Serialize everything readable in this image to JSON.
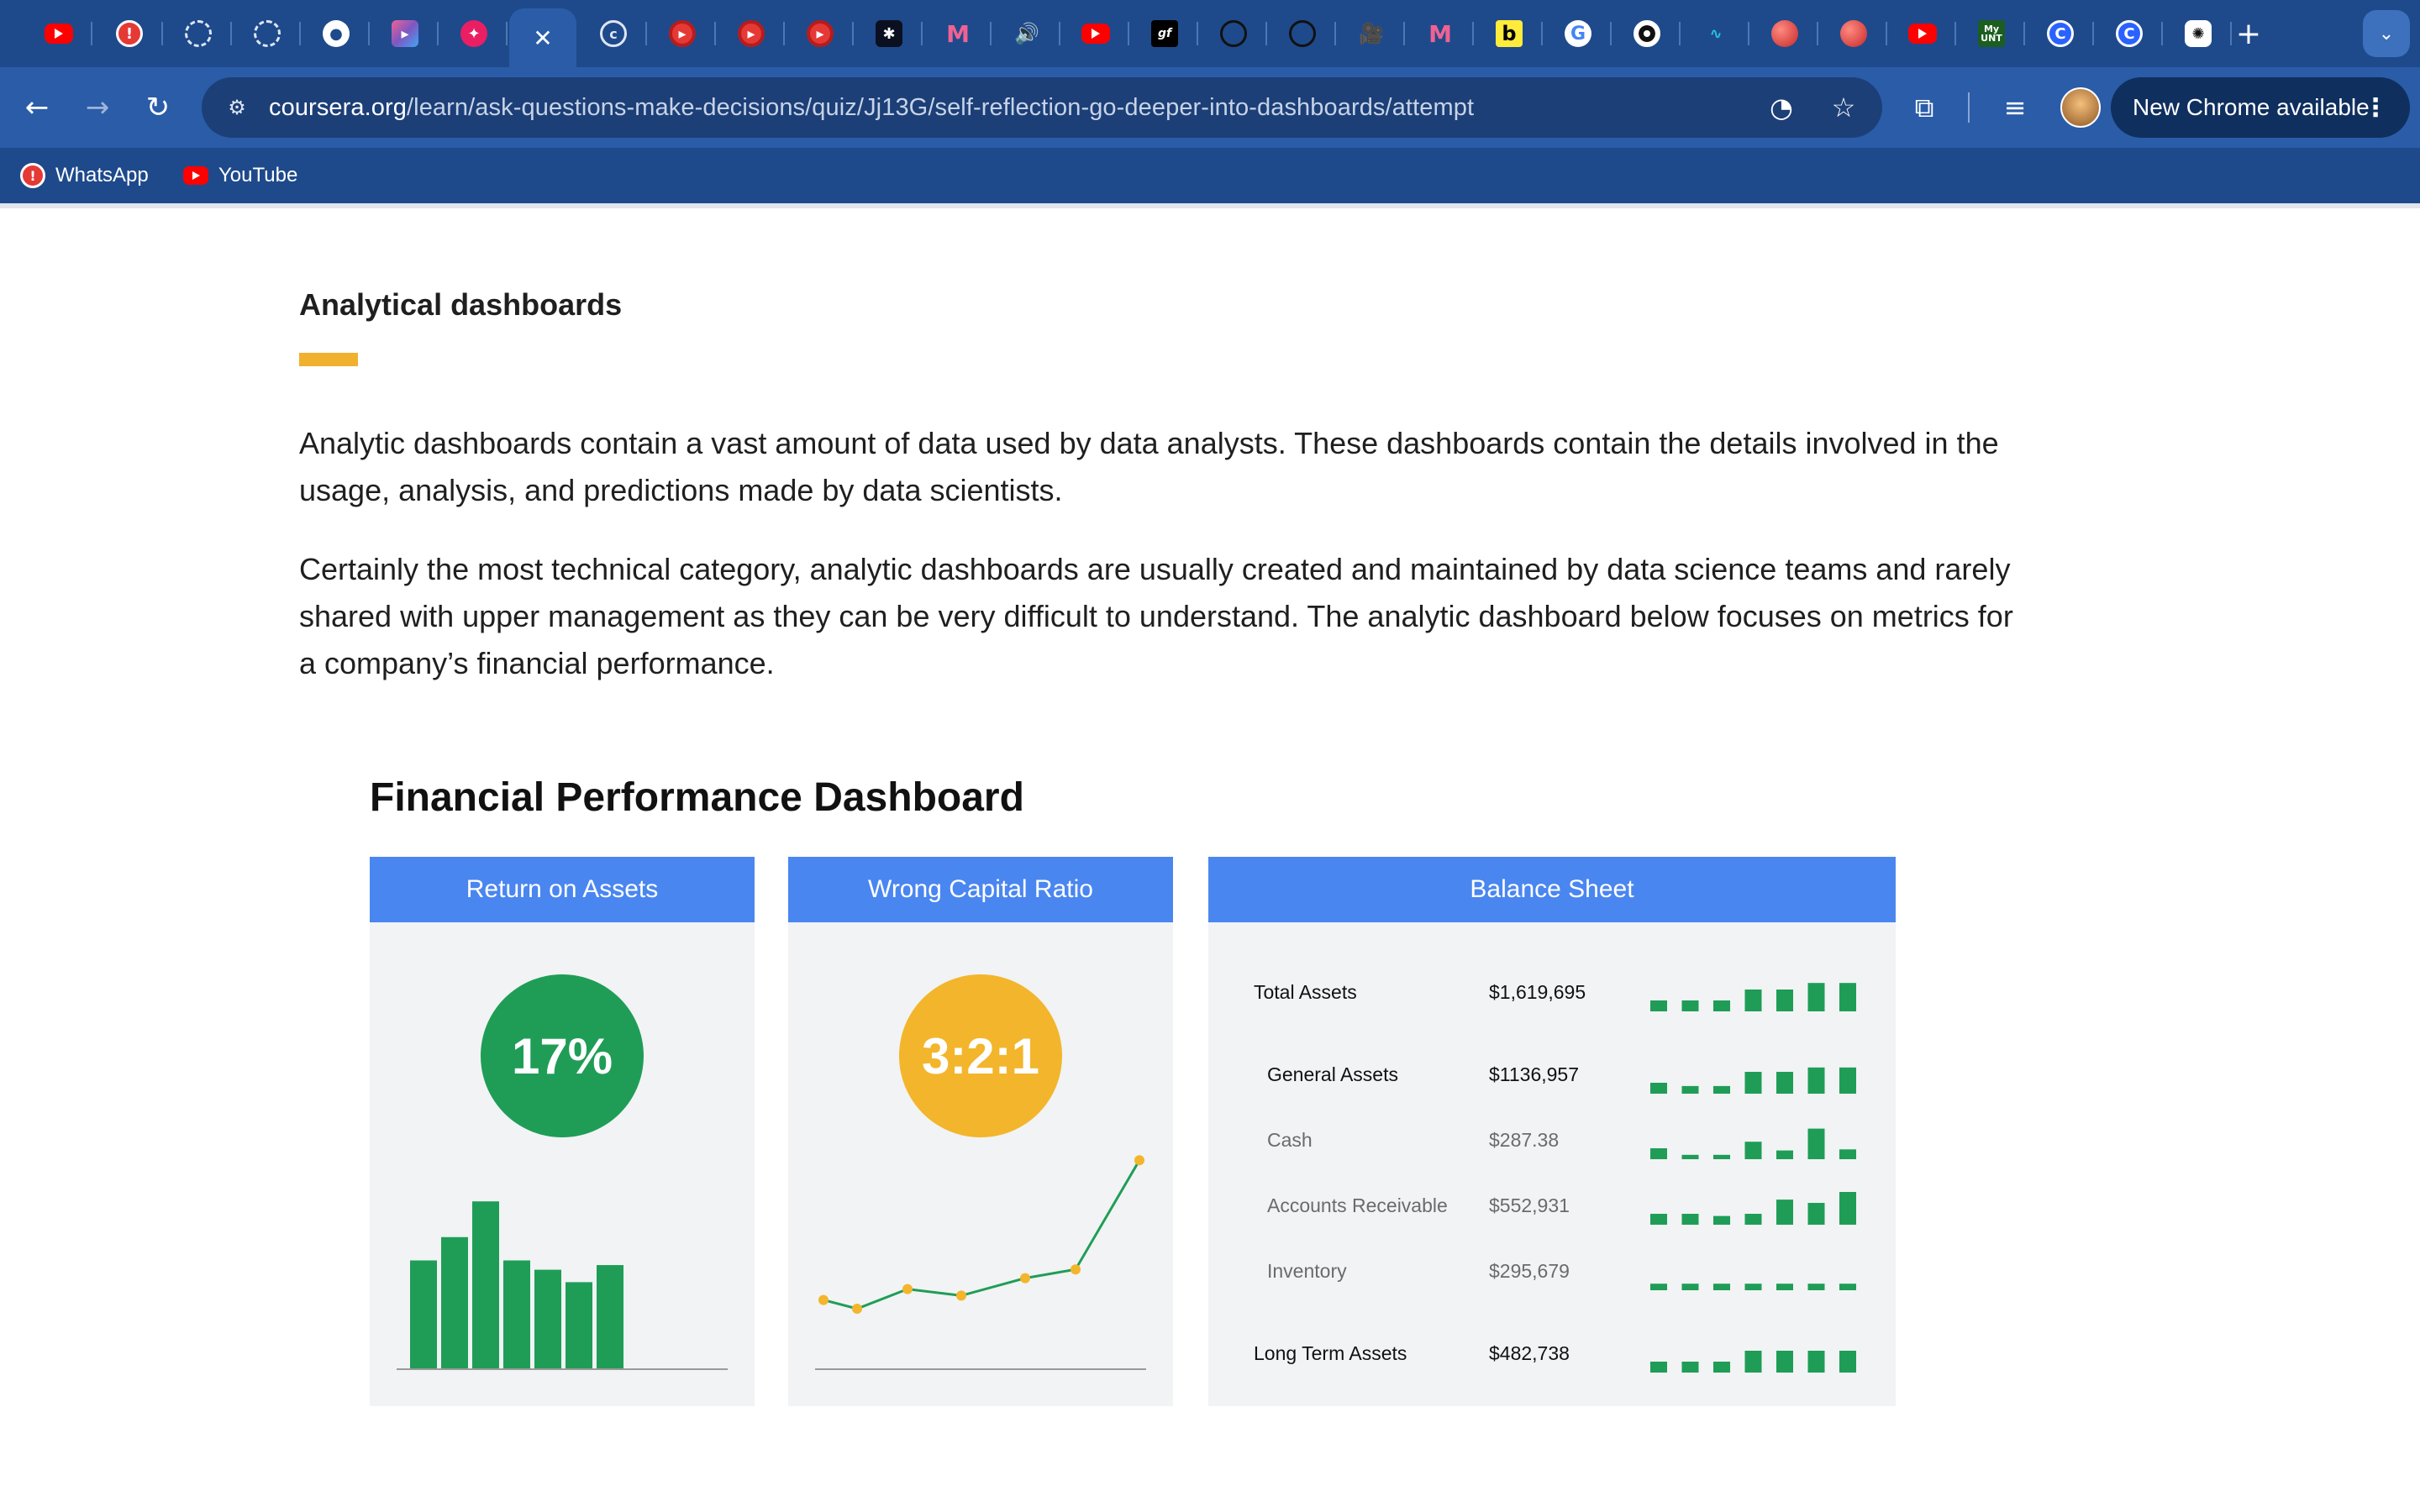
{
  "browser": {
    "url_host": "coursera.org",
    "url_path": "/learn/ask-questions-make-decisions/quiz/Jj13G/self-reflection-go-deeper-into-dashboards/attempt",
    "update_label": "New Chrome available",
    "tabs": [
      {
        "icon": "youtube-icon",
        "cls": "yt",
        "glyph": ""
      },
      {
        "icon": "warning-icon",
        "cls": "warn",
        "glyph": "!"
      },
      {
        "icon": "loading-icon",
        "cls": "ring",
        "glyph": ""
      },
      {
        "icon": "loading-icon",
        "cls": "ring",
        "glyph": ""
      },
      {
        "icon": "github-icon",
        "cls": "gh",
        "glyph": "●"
      },
      {
        "icon": "gradient-app-icon",
        "cls": "grad",
        "glyph": "▸"
      },
      {
        "icon": "pink-app-icon",
        "cls": "pink",
        "glyph": "✦"
      },
      {
        "icon": "close-icon",
        "cls": "active",
        "glyph": "✕"
      },
      {
        "icon": "coursera-icon",
        "cls": "coursera",
        "glyph": "c"
      },
      {
        "icon": "red-record-icon",
        "cls": "redring",
        "glyph": "▸"
      },
      {
        "icon": "red-record-icon",
        "cls": "redring",
        "glyph": "▸"
      },
      {
        "icon": "red-record-icon",
        "cls": "redring",
        "glyph": "▸"
      },
      {
        "icon": "space-app-icon",
        "cls": "dark",
        "glyph": "✱"
      },
      {
        "icon": "m-logo-icon",
        "cls": "m",
        "glyph": "M"
      },
      {
        "icon": "audio-playing-icon",
        "cls": "spk",
        "glyph": "🔊"
      },
      {
        "icon": "youtube-icon",
        "cls": "yt",
        "glyph": ""
      },
      {
        "icon": "script-app-icon",
        "cls": "black",
        "glyph": "gf"
      },
      {
        "icon": "openai-icon",
        "cls": "oai",
        "glyph": ""
      },
      {
        "icon": "openai-icon",
        "cls": "oai",
        "glyph": ""
      },
      {
        "icon": "video-camera-icon",
        "cls": "cam",
        "glyph": "🎥"
      },
      {
        "icon": "m-logo-icon",
        "cls": "m",
        "glyph": "M"
      },
      {
        "icon": "b-logo-icon",
        "cls": "b",
        "glyph": "b"
      },
      {
        "icon": "google-icon",
        "cls": "g",
        "glyph": "G"
      },
      {
        "icon": "target-icon",
        "cls": "target",
        "glyph": ""
      },
      {
        "icon": "wave-icon",
        "cls": "wave",
        "glyph": "∿"
      },
      {
        "icon": "red-ball-icon",
        "cls": "ball",
        "glyph": ""
      },
      {
        "icon": "red-ball-icon",
        "cls": "ball",
        "glyph": ""
      },
      {
        "icon": "youtube-icon",
        "cls": "yt",
        "glyph": ""
      },
      {
        "icon": "my-unt-icon",
        "cls": "unt",
        "glyph": "My UNT"
      },
      {
        "icon": "c-logo-icon",
        "cls": "c",
        "glyph": "C"
      },
      {
        "icon": "c-logo-icon",
        "cls": "c",
        "glyph": "C"
      },
      {
        "icon": "chatgpt-icon",
        "cls": "gpt",
        "glyph": "✺"
      }
    ],
    "bookmarks": [
      {
        "label": "WhatsApp",
        "icon": "warning-icon"
      },
      {
        "label": "YouTube",
        "icon": "youtube-icon"
      }
    ]
  },
  "content": {
    "section_title": "Analytical dashboards",
    "para1": "Analytic dashboards contain a vast amount of data used by data analysts. These dashboards contain the details involved in the usage, analysis, and predictions made by data scientists.",
    "para2": "Certainly the most technical category, analytic dashboards are usually created and maintained by data science teams and rarely shared with upper management as they can be very difficult to understand. The analytic dashboard below focuses on metrics for a company’s financial performance."
  },
  "dashboard": {
    "title": "Financial Performance Dashboard",
    "roa": {
      "header": "Return on Assets",
      "kpi": "17%"
    },
    "wcr": {
      "header": "Wrong Capital Ratio",
      "kpi": "3:2:1"
    },
    "bs": {
      "header": "Balance Sheet",
      "rows": [
        {
          "label": "Total Assets",
          "value": "$1,619,695",
          "kind": "group"
        },
        {
          "label": "General Assets",
          "value": "$1136,957",
          "kind": "group"
        },
        {
          "label": "Cash",
          "value": "$287.38",
          "kind": "sub"
        },
        {
          "label": "Accounts Receivable",
          "value": "$552,931",
          "kind": "sub"
        },
        {
          "label": "Inventory",
          "value": "$295,679",
          "kind": "sub"
        },
        {
          "label": "Long Term Assets",
          "value": "$482,738",
          "kind": "group"
        }
      ]
    },
    "colors": {
      "green": "#1f9d57",
      "amber": "#f3b52b",
      "header_blue": "#4a86f0",
      "panel_bg": "#f1f3f4"
    }
  },
  "chart_data": [
    {
      "type": "bar",
      "categories": [
        "1",
        "2",
        "3",
        "4",
        "5",
        "6",
        "7"
      ],
      "values": [
        70,
        85,
        108,
        70,
        64,
        56,
        67
      ]
    },
    {
      "type": "line",
      "x": [
        1,
        2,
        3,
        4,
        5,
        6,
        7
      ],
      "values": [
        24,
        20,
        29,
        26,
        34,
        38,
        88
      ]
    },
    {
      "type": "bar",
      "series": [
        {
          "values": [
            1.0,
            1.0,
            1.0,
            2.0,
            2.0,
            2.6,
            2.6
          ]
        },
        {
          "values": [
            1.0,
            0.7,
            0.7,
            2.0,
            2.0,
            2.4,
            2.4
          ]
        },
        {
          "values": [
            1.0,
            0.4,
            0.4,
            1.6,
            0.8,
            2.8,
            0.9
          ]
        },
        {
          "values": [
            1.0,
            1.0,
            0.8,
            1.0,
            2.3,
            2.0,
            3.0
          ]
        },
        {
          "values": [
            0.6,
            0.6,
            0.6,
            0.6,
            0.6,
            0.6,
            0.6
          ]
        },
        {
          "values": [
            1.0,
            1.0,
            1.0,
            2.0,
            2.0,
            2.0,
            2.0
          ]
        }
      ]
    }
  ]
}
